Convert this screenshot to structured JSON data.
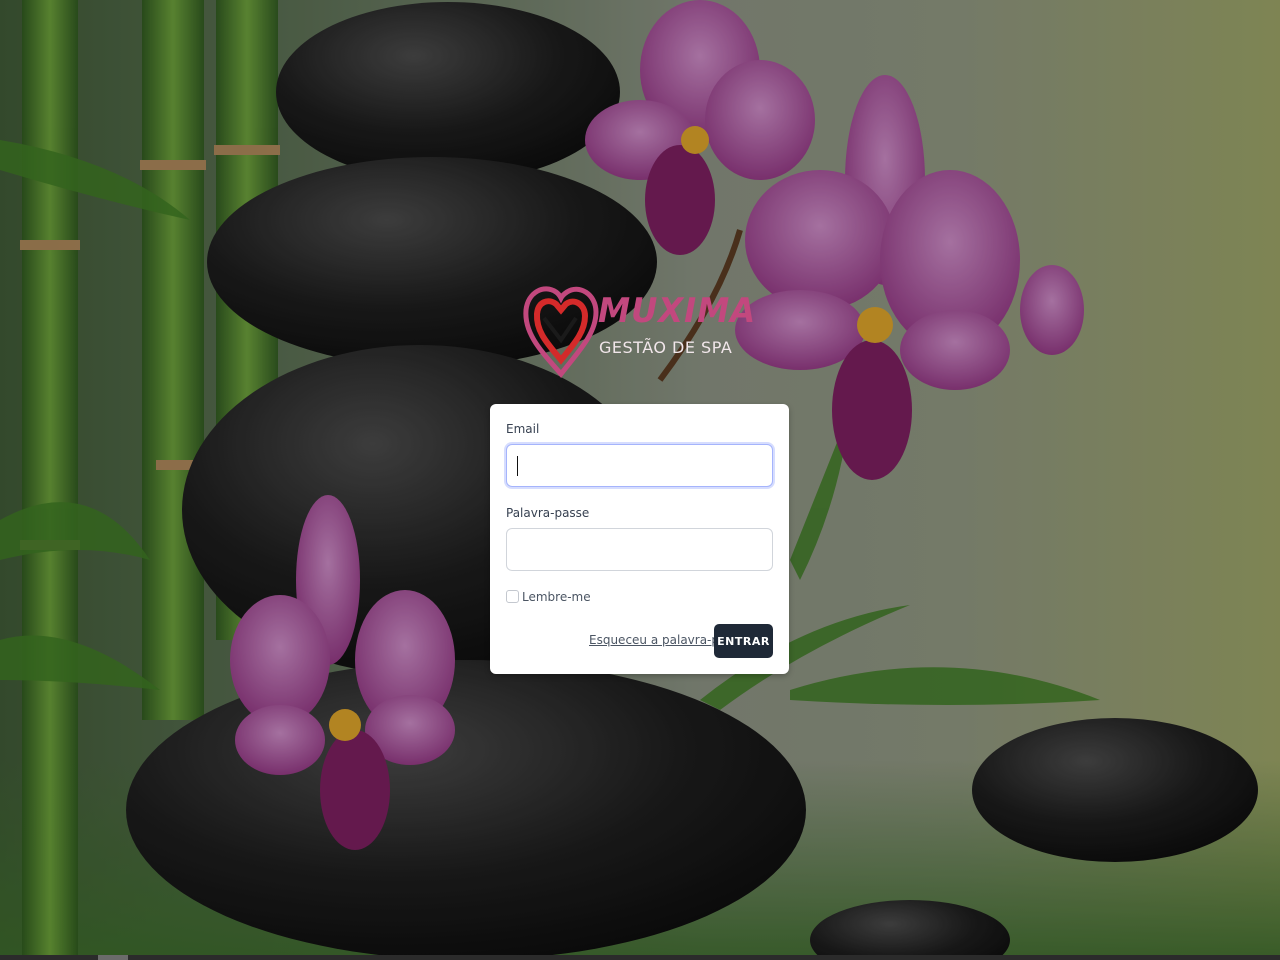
{
  "brand": {
    "name": "MUXIMA",
    "tagline": "GESTÃO DE SPA",
    "logo_icon": "heart-logo-icon",
    "accent_color": "#c2487e"
  },
  "login_form": {
    "email_label": "Email",
    "email_value": "",
    "password_label": "Palavra-passe",
    "password_value": "",
    "remember_label": "Lembre-me",
    "remember_checked": false,
    "forgot_link": "Esqueceu a palavra-passe?",
    "submit_label": "ENTRAR",
    "submit_color": "#1f2937"
  },
  "background": {
    "description_icon": "spa-stones-orchids-background"
  }
}
